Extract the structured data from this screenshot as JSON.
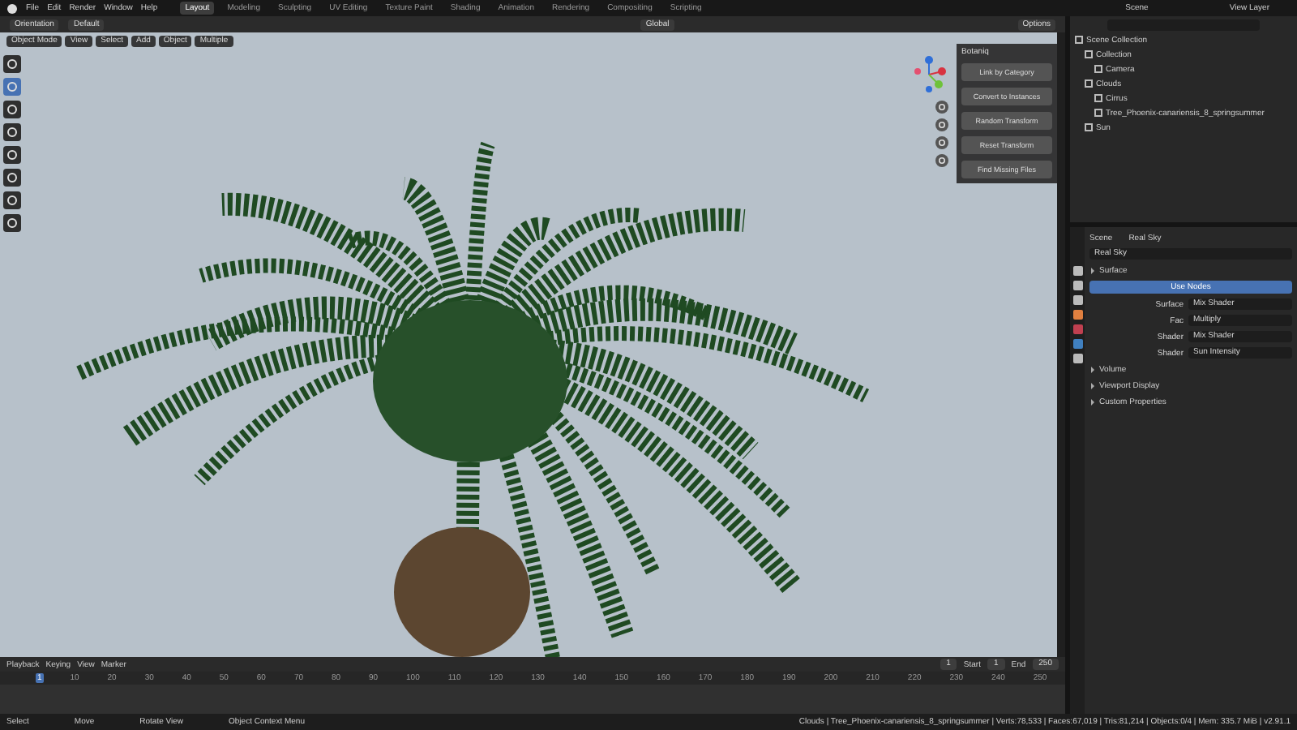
{
  "menu": [
    "File",
    "Edit",
    "Render",
    "Window",
    "Help"
  ],
  "workspaces": [
    {
      "label": "Layout",
      "selected": true
    },
    {
      "label": "Modeling",
      "selected": false
    },
    {
      "label": "Sculpting",
      "selected": false
    },
    {
      "label": "UV Editing",
      "selected": false
    },
    {
      "label": "Texture Paint",
      "selected": false
    },
    {
      "label": "Shading",
      "selected": false
    },
    {
      "label": "Animation",
      "selected": false
    },
    {
      "label": "Rendering",
      "selected": false
    },
    {
      "label": "Compositing",
      "selected": false
    },
    {
      "label": "Scripting",
      "selected": false
    }
  ],
  "tool_header": {
    "orientation": "Orientation",
    "pivot": "Default",
    "transform": "Global",
    "options": "Options"
  },
  "viewport_header": {
    "mode": "Object Mode",
    "menus": [
      "View",
      "Select",
      "Add",
      "Object"
    ],
    "dropdown": "Multiple"
  },
  "sidebar_panel": {
    "title": "Botaniq",
    "buttons": [
      "Link by Category",
      "Convert to Instances",
      "Random Transform",
      "Reset Transform",
      "Find Missing Files"
    ]
  },
  "topbar_right": {
    "scene": "Scene",
    "view_layer": "View Layer"
  },
  "outliner": {
    "items": [
      {
        "label": "Scene Collection",
        "children": [
          {
            "label": "Collection",
            "children": [
              {
                "label": "Camera"
              }
            ]
          },
          {
            "label": "Clouds",
            "children": [
              {
                "label": "Cirrus"
              },
              {
                "label": "Tree_Phoenix-canariensis_8_springsummer"
              }
            ]
          },
          {
            "label": "Sun"
          }
        ]
      }
    ]
  },
  "properties": {
    "breadcrumb": [
      "Scene",
      "Real Sky"
    ],
    "world_name": "Real Sky",
    "section": "Surface",
    "use_nodes": "Use Nodes",
    "rows": [
      {
        "label": "Surface",
        "value": "Mix Shader"
      },
      {
        "label": "Fac",
        "value": "Multiply"
      },
      {
        "label": "Shader",
        "value": "Mix Shader"
      },
      {
        "label": "Shader",
        "value": "Sun Intensity"
      }
    ],
    "collapsed": [
      "Volume",
      "Viewport Display",
      "Custom Properties"
    ]
  },
  "timeline": {
    "menus": [
      "Playback",
      "Keying",
      "View",
      "Marker"
    ],
    "current_frame": "1",
    "start_label": "Start",
    "start": "1",
    "end_label": "End",
    "end": "250",
    "ticks": [
      "1",
      "10",
      "20",
      "30",
      "40",
      "50",
      "60",
      "70",
      "80",
      "90",
      "100",
      "110",
      "120",
      "130",
      "140",
      "150",
      "160",
      "170",
      "180",
      "190",
      "200",
      "210",
      "220",
      "230",
      "240",
      "250"
    ]
  },
  "status_bar": {
    "hints": [
      "Select",
      "Move",
      "Rotate View",
      "Object Context Menu"
    ],
    "stats": "Clouds | Tree_Phoenix-canariensis_8_springsummer | Verts:78,533 | Faces:67,019 | Tris:81,214 | Objects:0/4 | Mem: 335.7 MiB | v2.91.1"
  }
}
